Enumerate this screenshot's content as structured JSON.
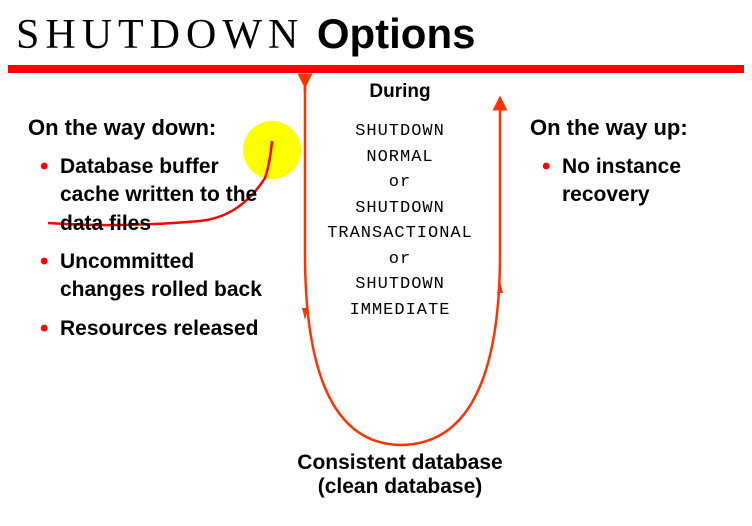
{
  "title": {
    "word1": "SHUTDOWN",
    "word2": "Options"
  },
  "colors": {
    "accent": "#ff0000",
    "highlight": "#ffff00"
  },
  "left": {
    "heading": "On the way down:",
    "items": [
      "Database buffer cache written to the data files",
      "Uncommitted changes rolled back",
      "Resources released"
    ]
  },
  "center": {
    "heading": "During",
    "lines": [
      "SHUTDOWN",
      "NORMAL",
      "or",
      "SHUTDOWN",
      "TRANSACTIONAL",
      "or",
      "SHUTDOWN",
      "IMMEDIATE"
    ]
  },
  "right": {
    "heading": "On the way up:",
    "items": [
      "No instance recovery"
    ]
  },
  "bottom": {
    "line1": "Consistent database",
    "line2": "(clean database)"
  }
}
